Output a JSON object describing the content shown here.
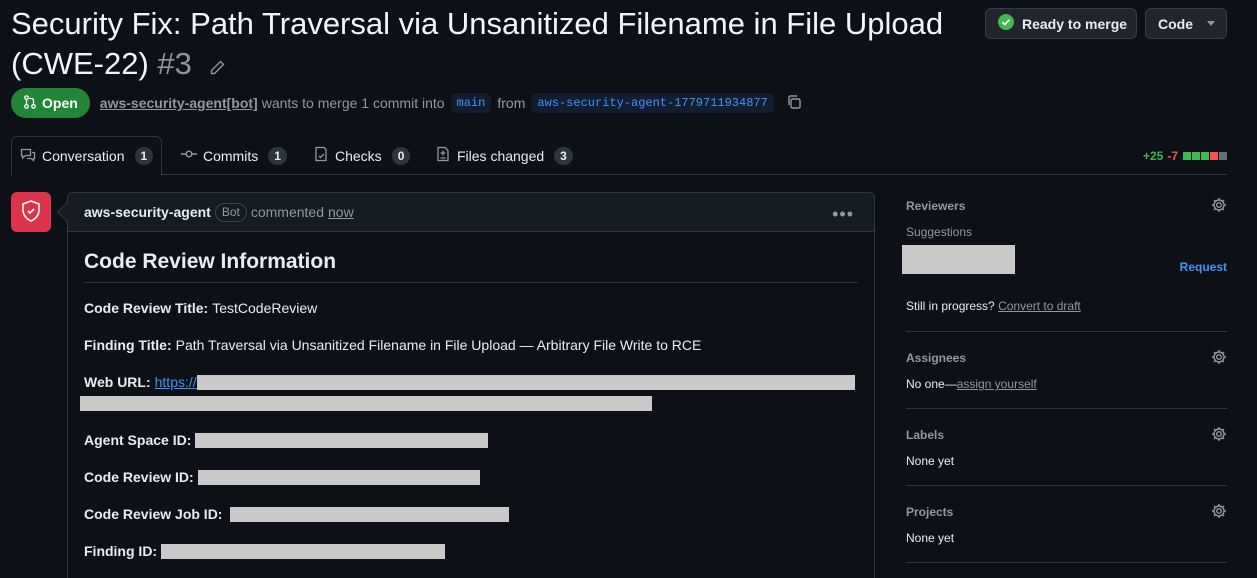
{
  "pr": {
    "title": "Security Fix: Path Traversal via Unsanitized Filename in File Upload (CWE-22)",
    "number": "#3",
    "status": "Open",
    "author": "aws-security-agent[bot]",
    "merge_text": "wants to merge 1 commit into",
    "base_branch": "main",
    "from_text": "from",
    "head_branch": "aws-security-agent-1779711934877"
  },
  "header": {
    "ready_label": "Ready to merge",
    "code_label": "Code"
  },
  "tabs": [
    {
      "label": "Conversation",
      "count": "1"
    },
    {
      "label": "Commits",
      "count": "1"
    },
    {
      "label": "Checks",
      "count": "0"
    },
    {
      "label": "Files changed",
      "count": "3"
    }
  ],
  "diffstat": {
    "additions": "+25",
    "deletions": "-7"
  },
  "comment": {
    "author": "aws-security-agent",
    "badge": "Bot",
    "action": "commented",
    "time": "now",
    "heading": "Code Review Information",
    "fields": {
      "title_label": "Code Review Title:",
      "title_value": "TestCodeReview",
      "finding_label": "Finding Title:",
      "finding_value": "Path Traversal via Unsanitized Filename in File Upload — Arbitrary File Write to RCE",
      "url_label": "Web URL:",
      "url_value": "https://",
      "space_label": "Agent Space ID:",
      "review_label": "Code Review ID:",
      "job_label": "Code Review Job ID:",
      "findingid_label": "Finding ID:"
    }
  },
  "sidebar": {
    "reviewers": "Reviewers",
    "suggestions": "Suggestions",
    "request": "Request",
    "progress": "Still in progress?",
    "draft": "Convert to draft",
    "assignees": "Assignees",
    "no_one": "No one—",
    "assign_self": "assign yourself",
    "labels": "Labels",
    "labels_value": "None yet",
    "projects": "Projects",
    "projects_value": "None yet"
  },
  "colors": {
    "accent": "#4493f8",
    "open": "#238636",
    "avatar": "#dd344c",
    "add": "#3fb950",
    "del": "#f85149"
  }
}
